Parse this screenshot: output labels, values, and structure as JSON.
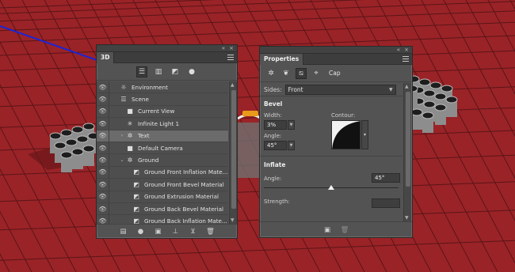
{
  "colors": {
    "canvas_red": "#9a2327",
    "grid_line": "#5a1518",
    "axis_blue": "#1a24d8",
    "panel_bg": "#535353",
    "selected_row": "#6b6b6b"
  },
  "panel3d": {
    "title": "3D",
    "filter_icons": [
      "scene-filter-icon",
      "mesh-filter-icon",
      "material-filter-icon",
      "light-filter-icon"
    ],
    "layers": [
      {
        "name": "Environment",
        "icon": "environment-icon",
        "indent": 0,
        "arrow": ""
      },
      {
        "name": "Scene",
        "icon": "scene-icon",
        "indent": 0,
        "arrow": ""
      },
      {
        "name": "Current View",
        "icon": "camera-icon",
        "indent": 1,
        "arrow": ""
      },
      {
        "name": "Infinite Light 1",
        "icon": "light-icon",
        "indent": 1,
        "arrow": ""
      },
      {
        "name": "Text",
        "icon": "mesh-icon",
        "indent": 1,
        "arrow": "›",
        "selected": true
      },
      {
        "name": "Default Camera",
        "icon": "camera-icon",
        "indent": 1,
        "arrow": ""
      },
      {
        "name": "Ground",
        "icon": "mesh-icon",
        "indent": 1,
        "arrow": "⌄"
      },
      {
        "name": "Ground Front Inflation Mate...",
        "icon": "material-icon",
        "indent": 2,
        "arrow": ""
      },
      {
        "name": "Ground Front Bevel Material",
        "icon": "material-icon",
        "indent": 2,
        "arrow": ""
      },
      {
        "name": "Ground Extrusion Material",
        "icon": "material-icon",
        "indent": 2,
        "arrow": ""
      },
      {
        "name": "Ground Back Bevel Material",
        "icon": "material-icon",
        "indent": 2,
        "arrow": ""
      },
      {
        "name": "Ground Back Inflation Mate...",
        "icon": "material-icon",
        "indent": 2,
        "arrow": ""
      }
    ],
    "footer_icons": [
      "mesh-menu-icon",
      "light-menu-icon",
      "render-icon",
      "ground-icon",
      "drop-to-plane-icon",
      "trash-icon"
    ]
  },
  "properties": {
    "title": "Properties",
    "tool_icons": [
      "mesh-tab-icon",
      "deform-tab-icon",
      "cap-tab-icon",
      "coordinates-tab-icon"
    ],
    "active_tab": "Cap",
    "sides_label": "Sides:",
    "sides_value": "Front",
    "bevel_title": "Bevel",
    "width_label": "Width:",
    "width_value": "3%",
    "contour_label": "Contour:",
    "angle_label": "Angle:",
    "angle_value": "45°",
    "inflate_title": "Inflate",
    "inflate_angle_label": "Angle:",
    "inflate_angle_value": "45°",
    "inflate_angle_fraction": 0.5,
    "strength_label": "Strength:",
    "footer_icons": [
      "render-icon",
      "trash-icon"
    ]
  }
}
